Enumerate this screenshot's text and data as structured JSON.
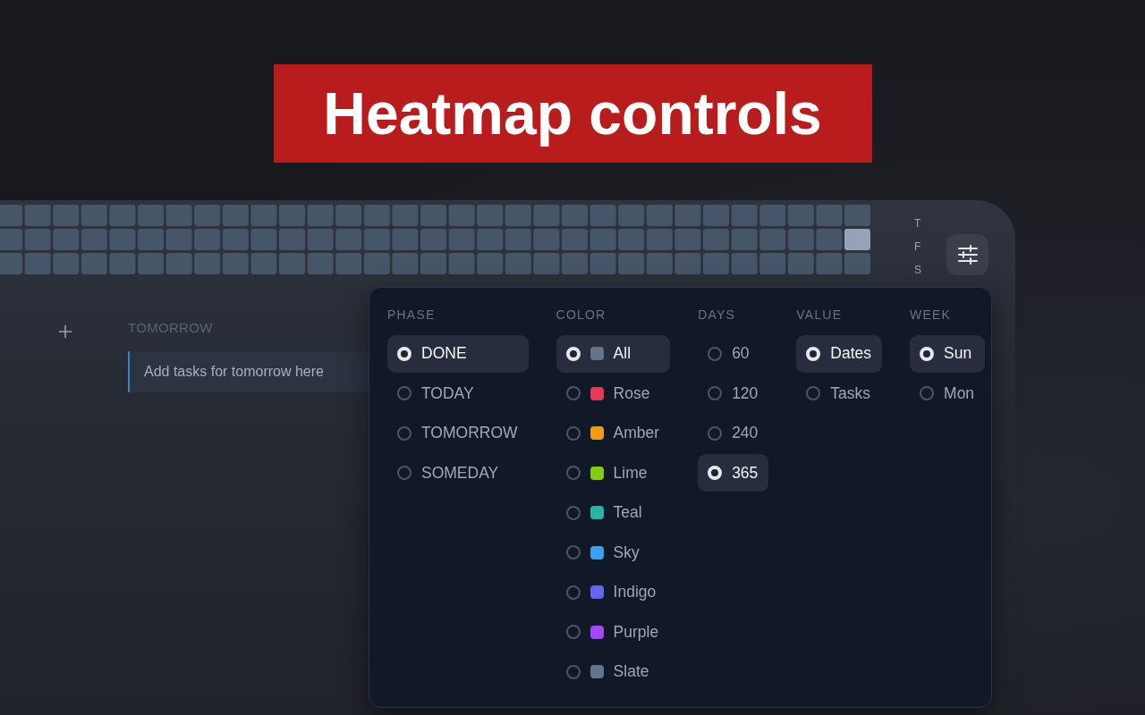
{
  "banner": {
    "title": "Heatmap controls"
  },
  "heatmap": {
    "day_labels": [
      "T",
      "F",
      "S"
    ]
  },
  "board": {
    "column_title": "TOMORROW",
    "task_placeholder": "Add tasks for tomorrow here"
  },
  "filters": [
    {
      "label": "PHASE",
      "options": [
        {
          "label": "DONE",
          "selected": true
        },
        {
          "label": "TODAY",
          "selected": false
        },
        {
          "label": "TOMORROW",
          "selected": false
        },
        {
          "label": "SOMEDAY",
          "selected": false
        }
      ]
    },
    {
      "label": "COLOR",
      "options": [
        {
          "label": "All",
          "selected": true,
          "color": "#64748b"
        },
        {
          "label": "Rose",
          "selected": false,
          "color": "#e8385a"
        },
        {
          "label": "Amber",
          "selected": false,
          "color": "#f39c12"
        },
        {
          "label": "Lime",
          "selected": false,
          "color": "#84cc16"
        },
        {
          "label": "Teal",
          "selected": false,
          "color": "#2db3a6"
        },
        {
          "label": "Sky",
          "selected": false,
          "color": "#3aa0ef"
        },
        {
          "label": "Indigo",
          "selected": false,
          "color": "#6366f1"
        },
        {
          "label": "Purple",
          "selected": false,
          "color": "#a24bf5"
        },
        {
          "label": "Slate",
          "selected": false,
          "color": "#64748b"
        }
      ]
    },
    {
      "label": "DAYS",
      "options": [
        {
          "label": "60",
          "selected": false
        },
        {
          "label": "120",
          "selected": false
        },
        {
          "label": "240",
          "selected": false
        },
        {
          "label": "365",
          "selected": true
        }
      ]
    },
    {
      "label": "VALUE",
      "options": [
        {
          "label": "Dates",
          "selected": true
        },
        {
          "label": "Tasks",
          "selected": false
        }
      ]
    },
    {
      "label": "WEEK",
      "options": [
        {
          "label": "Sun",
          "selected": true
        },
        {
          "label": "Mon",
          "selected": false
        }
      ]
    }
  ]
}
